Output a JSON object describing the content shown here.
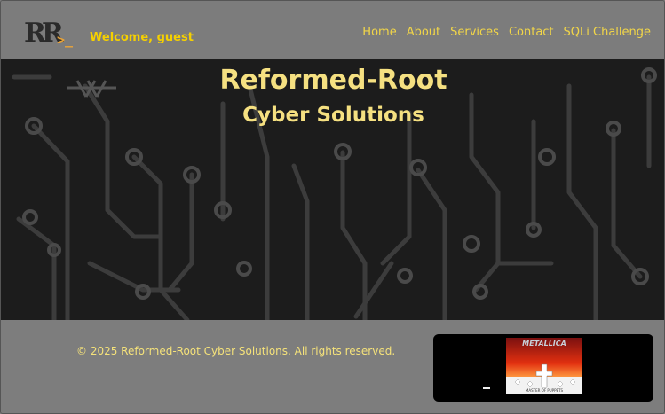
{
  "header": {
    "logo_letters": "RR",
    "logo_prompt": ">_",
    "welcome": "Welcome, guest",
    "nav": [
      {
        "label": "Home"
      },
      {
        "label": "About"
      },
      {
        "label": "Services"
      },
      {
        "label": "Contact"
      },
      {
        "label": "SQLi Challenge"
      }
    ]
  },
  "hero": {
    "title": "Reformed-Root",
    "subtitle": "Cyber Solutions"
  },
  "footer": {
    "copyright": "© 2025 Reformed-Root Cyber Solutions. All rights reserved."
  },
  "player": {
    "album_brand": "METALLICA",
    "album_title": "MASTER OF PUPPETS"
  },
  "colors": {
    "accent": "#f2d648",
    "welcome": "#f5d000",
    "hero_bg": "#1c1c1c",
    "page_bg": "#7d7d7d"
  }
}
